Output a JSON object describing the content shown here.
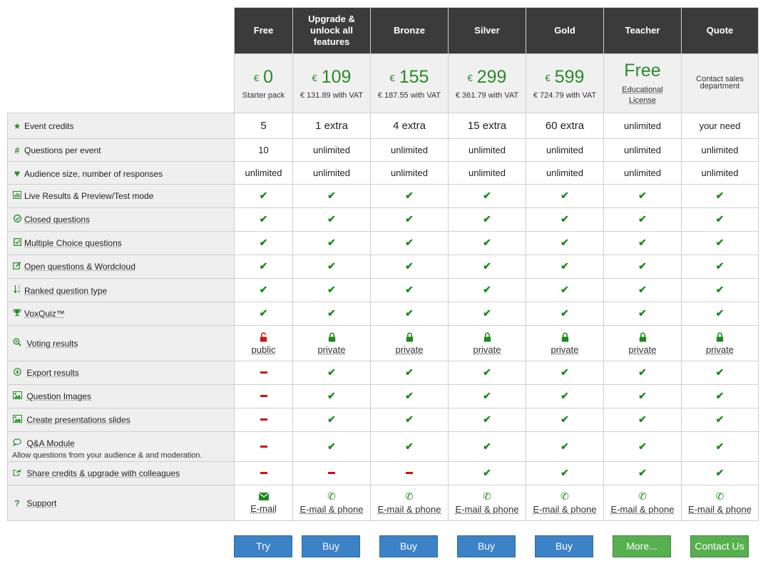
{
  "plans": [
    {
      "name": "Free"
    },
    {
      "name": "Upgrade & unlock all features"
    },
    {
      "name": "Bronze"
    },
    {
      "name": "Silver"
    },
    {
      "name": "Gold"
    },
    {
      "name": "Teacher"
    },
    {
      "name": "Quote"
    }
  ],
  "prices": {
    "currency": "€",
    "free": {
      "amount": "0",
      "sub": "Starter pack"
    },
    "upgrade": {
      "amount": "109",
      "sub": "€ 131.89 with VAT"
    },
    "bronze": {
      "amount": "155",
      "sub": "€ 187.55 with VAT"
    },
    "silver": {
      "amount": "299",
      "sub": "€ 361.79 with VAT"
    },
    "gold": {
      "amount": "599",
      "sub": "€ 724.79 with VAT"
    },
    "teacher": {
      "amount": "Free",
      "sub": "Educational License"
    },
    "quote": {
      "sub": "Contact sales department"
    }
  },
  "features": {
    "event_credits": {
      "label": "Event credits",
      "values": [
        "5",
        "1 extra",
        "4 extra",
        "15 extra",
        "60 extra",
        "unlimited",
        "your need"
      ]
    },
    "questions": {
      "label": "Questions per event",
      "values": [
        "10",
        "unlimited",
        "unlimited",
        "unlimited",
        "unlimited",
        "unlimited",
        "unlimited"
      ]
    },
    "audience": {
      "label": "Audience size, number of responses",
      "values": [
        "unlimited",
        "unlimited",
        "unlimited",
        "unlimited",
        "unlimited",
        "unlimited",
        "unlimited"
      ]
    },
    "live": {
      "label": "Live Results & Preview/Test mode"
    },
    "closed": {
      "label": "Closed questions"
    },
    "multiple": {
      "label": "Multiple Choice questions"
    },
    "open": {
      "label": "Open questions & Wordcloud"
    },
    "ranked": {
      "label": "Ranked question type"
    },
    "voxquiz": {
      "label": "VoxQuiz™"
    },
    "voting": {
      "label": "Voting results",
      "values": [
        "public",
        "private",
        "private",
        "private",
        "private",
        "private",
        "private"
      ]
    },
    "export": {
      "label": "Export results"
    },
    "images": {
      "label": "Question Images"
    },
    "slides": {
      "label": "Create presentations slides"
    },
    "qa": {
      "label": "Q&A Module",
      "desc": "Allow questions from your audience & and moderation."
    },
    "share": {
      "label": "Share credits & upgrade with colleagues"
    },
    "support": {
      "label": "Support",
      "values": [
        "E-mail",
        "E-mail & phone",
        "E-mail & phone",
        "E-mail & phone",
        "E-mail & phone",
        "E-mail & phone",
        "E-mail & phone"
      ]
    }
  },
  "icons": {
    "check": "✔",
    "star": "★",
    "hash": "#",
    "heart": "♥",
    "phone": "✆",
    "question": "?"
  },
  "colors": {
    "header_bg": "#3b3b3b",
    "price_green": "#2a8a2a",
    "check_green": "#1d8a1d",
    "dash_red": "#cc1111",
    "button_blue": "#3c82c6",
    "button_green": "#56b04f"
  },
  "buttons": {
    "try": "Try",
    "buy_upgrade": "Buy",
    "buy_bronze": "Buy",
    "buy_silver": "Buy",
    "buy_gold": "Buy",
    "more": "More...",
    "contact": "Contact Us"
  }
}
